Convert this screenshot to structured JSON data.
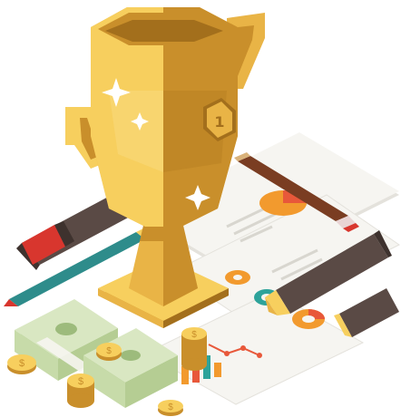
{
  "illustration": {
    "trophy": {
      "numeral": "1"
    },
    "coin_symbol": "$",
    "colors": {
      "gold_light": "#F7CF5E",
      "gold_mid": "#E9B446",
      "gold_dark": "#C98F2B",
      "gold_shadow": "#A36F1C",
      "paper": "#F6F5F1",
      "paper_shadow": "#E4E2DC",
      "marker_body": "#5A4A45",
      "marker_dark": "#3E322E",
      "marker_red": "#D8362E",
      "pencil_teal": "#2E8C8B",
      "money_green": "#D9E7C2",
      "money_dark": "#9DBB7C",
      "chart_red": "#E8583A",
      "chart_orange": "#F29A2E",
      "chart_teal": "#2DA39A"
    },
    "icons": [
      "sparkle-icon",
      "coin-icon",
      "dollar-bill-icon",
      "trophy-icon"
    ]
  }
}
